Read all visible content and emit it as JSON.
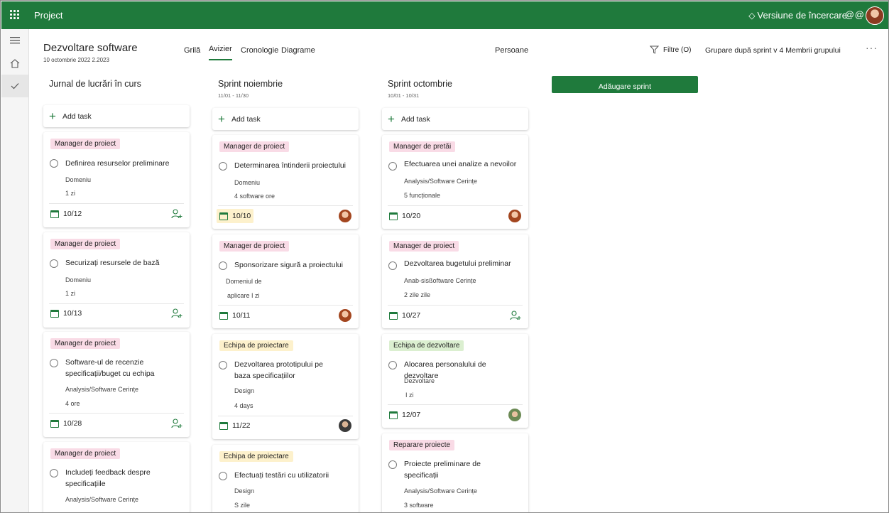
{
  "app": {
    "title": "Project",
    "trial_label": "Versiune de încercare",
    "colors": {
      "brand": "#1f7a3c",
      "label_pink": "#f9dbe6",
      "label_yellow": "#fdf1cc",
      "label_green": "#dbefd0"
    }
  },
  "header": {
    "project_name": "Dezvoltare software",
    "date_range": "10 octombrie 2022 2.2023",
    "tabs": [
      {
        "label": "Grilă",
        "active": false
      },
      {
        "label": "Avizier",
        "active": true
      },
      {
        "label": "Cronologie",
        "active": false
      },
      {
        "label": "Diagrame",
        "active": false
      }
    ],
    "people_label": "Persoane",
    "filter_label": "Filtre (O)",
    "grouping_label": "Grupare după sprint v 4 Membrii grupului",
    "more_label": "···"
  },
  "board": {
    "add_task_label": "Add task",
    "add_sprint_label": "Adăugare sprint",
    "columns": [
      {
        "title": "Jurnal de lucrări în curs",
        "range": "",
        "cards": [
          {
            "label": "Manager de proiect",
            "name": "Definirea resurselor preliminare",
            "meta1": "Domeniu",
            "meta2": "1 zi",
            "due": "10/12",
            "assignee": "assign-icon"
          },
          {
            "label": "Manager de proiect",
            "name": "Securizați resursele de bază",
            "meta1": "Domeniu",
            "meta2": "1 zi",
            "due": "10/13",
            "assignee": "assign-icon"
          },
          {
            "label": "Manager de proiect",
            "name": "Software-ul de recenzie specificații/buget cu echipa",
            "meta1": "Analysis/Software Cerințe",
            "meta2": "4 ore",
            "due": "10/28",
            "assignee": "assign-icon"
          },
          {
            "label": "Manager de proiect",
            "name": "Includeți feedback despre specificațiile",
            "meta1": "Analysis/Software Cerințe",
            "meta2": "",
            "due": "",
            "assignee": ""
          }
        ]
      },
      {
        "title": "Sprint noiembrie",
        "range": "11/01 - 11/30",
        "cards": [
          {
            "label": "Manager de proiect",
            "name": "Determinarea întinderii proiectului",
            "meta1": "Domeniu",
            "meta2": "4 software ore",
            "due": "10/10",
            "assignee": "avatar-woman"
          },
          {
            "label": "Manager de proiect",
            "name": "Sponsorizare sigură a proiectului",
            "meta1": "Domeniul de",
            "meta2": "aplicare I zi",
            "due": "10/11",
            "assignee": "avatar-woman"
          },
          {
            "label": "Echipa de proiectare",
            "name": "Dezvoltarea prototipului pe baza specificațiilor",
            "meta1": "Design",
            "meta2": "4 days",
            "due": "11/22",
            "assignee": "avatar-man"
          },
          {
            "label": "Echipa de proiectare",
            "name": "Efectuați testări cu utilizatorii",
            "meta1": "Design",
            "meta2": "S zile",
            "due": "",
            "assignee": ""
          }
        ]
      },
      {
        "title": "Sprint octombrie",
        "range": "10/01 - 10/31",
        "cards": [
          {
            "label": "Manager de pretăi",
            "name": "Efectuarea unei analize a nevoilor",
            "meta1": "Analysis/Software Cerințe",
            "meta2": "5 funcționale",
            "due": "10/20",
            "assignee": "avatar-woman"
          },
          {
            "label": "Manager de proiect",
            "name": "Dezvoltarea bugetului preliminar",
            "meta1": "Anab-sisßoftware Cerințe",
            "meta2": "2 zile zile",
            "due": "10/27",
            "assignee": "assign-icon"
          },
          {
            "label": "Echipa de dezvoltare",
            "name": "Alocarea personalului de dezvoltare",
            "meta1": "Dezvoltare",
            "meta2": "I zi",
            "due": "12/07",
            "assignee": "avatar-multi"
          },
          {
            "label": "Reparare proiecte",
            "name": "Proiecte preliminare de specificații",
            "meta1": "Analysis/Software Cerințe",
            "meta2": "3 software",
            "due": "",
            "assignee": ""
          }
        ]
      }
    ]
  }
}
